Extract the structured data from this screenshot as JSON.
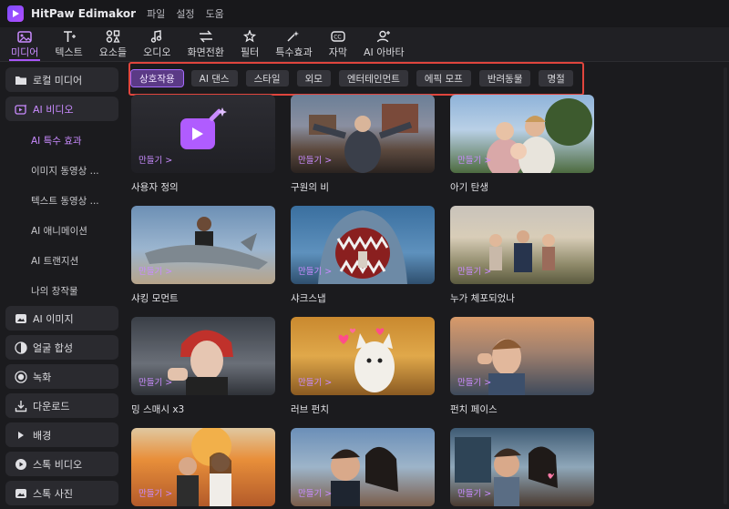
{
  "titlebar": {
    "app_title": "HitPaw Edimakor",
    "menu": [
      "파일",
      "설정",
      "도움"
    ]
  },
  "toolbar": {
    "tools": [
      {
        "label": "미디어",
        "icon": "media-icon",
        "active": true
      },
      {
        "label": "텍스트",
        "icon": "text-icon"
      },
      {
        "label": "요소들",
        "icon": "elements-icon"
      },
      {
        "label": "오디오",
        "icon": "audio-icon"
      },
      {
        "label": "화면전환",
        "icon": "transition-icon"
      },
      {
        "label": "필터",
        "icon": "filter-icon"
      },
      {
        "label": "특수효과",
        "icon": "effects-icon"
      },
      {
        "label": "자막",
        "icon": "subtitle-icon"
      },
      {
        "label": "AI 아바타",
        "icon": "avatar-icon"
      }
    ]
  },
  "sidebar": {
    "items": [
      {
        "label": "로컬 미디어",
        "icon": "folder-icon"
      },
      {
        "label": "AI 비디오",
        "icon": "ai-video-icon",
        "active": true
      },
      {
        "label": "AI 이미지",
        "icon": "ai-image-icon"
      },
      {
        "label": "얼굴 합성",
        "icon": "face-swap-icon"
      },
      {
        "label": "녹화",
        "icon": "record-icon"
      },
      {
        "label": "다운로드",
        "icon": "download-icon"
      },
      {
        "label": "배경",
        "icon": "triangle-icon"
      },
      {
        "label": "스톡 비디오",
        "icon": "play-icon"
      },
      {
        "label": "스톡 사진",
        "icon": "photo-icon"
      }
    ],
    "subitems": [
      "AI 특수 효과",
      "이미지 동영상 ...",
      "텍스트 동영상 ...",
      "AI 애니메이션",
      "AI 트랜지션",
      "나의 창작물"
    ]
  },
  "chips": [
    "상호작용",
    "AI 댄스",
    "스타일",
    "외모",
    "엔터테인먼트",
    "에픽 모프",
    "반려동물",
    "명절"
  ],
  "make_label": "만들기 >",
  "cards": [
    {
      "caption": "사용자 정의"
    },
    {
      "caption": "구원의 비"
    },
    {
      "caption": "아기 탄생"
    },
    {
      "caption": "샤킹 모먼트"
    },
    {
      "caption": "샤크스냅"
    },
    {
      "caption": "누가 체포되었나"
    },
    {
      "caption": "밍 스매시 x3"
    },
    {
      "caption": "러브 펀치"
    },
    {
      "caption": "펀치 페이스"
    },
    {
      "caption": ""
    },
    {
      "caption": ""
    },
    {
      "caption": ""
    }
  ],
  "colors": {
    "accent": "#a855f7",
    "highlight_border": "#e0453d"
  }
}
